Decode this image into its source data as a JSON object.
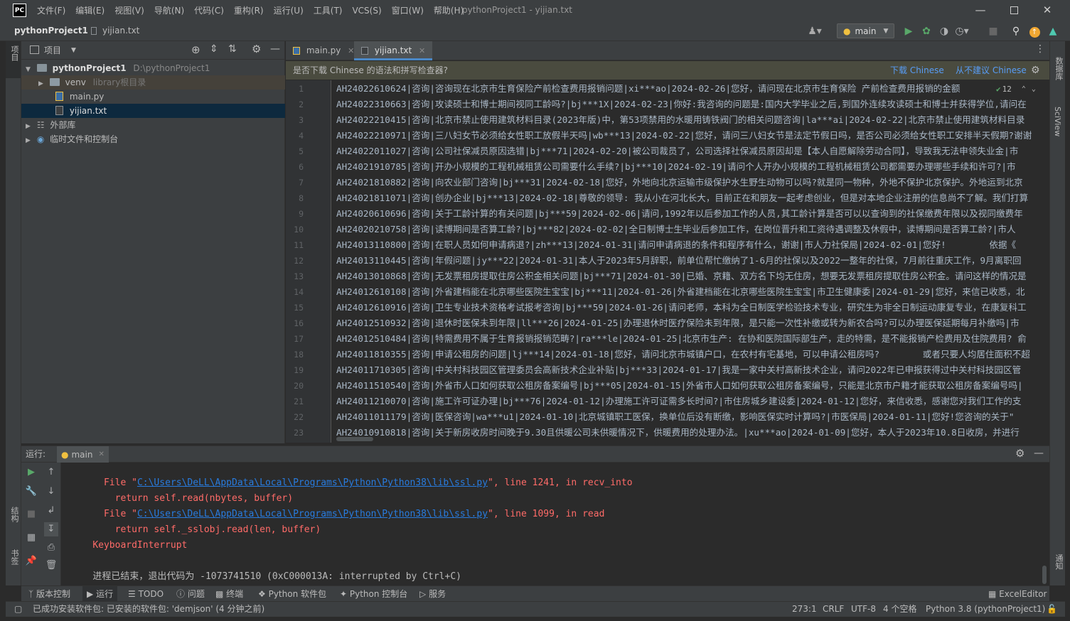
{
  "app_logo": "PC",
  "menu": [
    "文件(F)",
    "编辑(E)",
    "视图(V)",
    "导航(N)",
    "代码(C)",
    "重构(R)",
    "运行(U)",
    "工具(T)",
    "VCS(S)",
    "窗口(W)",
    "帮助(H)"
  ],
  "window_title": "pythonProject1 - yijian.txt",
  "breadcrumb": {
    "project": "pythonProject1",
    "file": "yijian.txt"
  },
  "run_config": "main",
  "project_panel": {
    "title": "项目",
    "tree": [
      {
        "label": "pythonProject1",
        "hint": "D:\\pythonProject1"
      },
      {
        "label": "venv",
        "hint": "library根目录"
      },
      {
        "label": "main.py",
        "hint": ""
      },
      {
        "label": "yijian.txt",
        "hint": ""
      },
      {
        "label": "外部库",
        "hint": ""
      },
      {
        "label": "临时文件和控制台",
        "hint": ""
      }
    ]
  },
  "editor": {
    "tabs": [
      {
        "label": "main.py"
      },
      {
        "label": "yijian.txt"
      }
    ],
    "notice": {
      "text": "是否下载 Chinese 的语法和拼写检查器?",
      "download": "下载 Chinese",
      "never": "从不建议 Chinese"
    },
    "inspection_count": "12",
    "lines": [
      "AH24022610624|咨询|咨询现在北京市生育保险产前检查费用报销问题|xi***ao|2024-02-26|您好，请问现在北京市生育保险 产前检查费用报销的金额",
      "AH24022310663|咨询|攻读硕士和博士期间视同工龄吗?|bj***1X|2024-02-23|你好:我咨询的问题是:国内大学毕业之后,到国外连续攻读硕士和博士并获得学位,请问在",
      "AH24022210415|咨询|北京市禁止使用建筑材料目录(2023年版)中，第53项禁用的水暖用铸铁阀门的相关问题咨询|la***ai|2024-02-22|北京市禁止使用建筑材料目录",
      "AH24022210971|咨询|三八妇女节必须给女性职工放假半天吗|wb***13|2024-02-22|您好，请问三八妇女节是法定节假日吗，是否公司必须给女性职工安排半天假期?谢谢",
      "AH24022011027|咨询|公司社保减员原因选错|bj***71|2024-02-20|被公司裁员了，公司选择社保减员原因却是【本人自愿解除劳动合同】，导致我无法申领失业金|市",
      "AH24021910785|咨询|开办小规模的工程机械租赁公司需要什么手续?|bj***10|2024-02-19|请问个人开办小规模的工程机械租赁公司都需要办理哪些手续和许可?|市",
      "AH24021810882|咨询|向农业部门咨询|bj***31|2024-02-18|您好，外地向北京运输市级保护水生野生动物可以吗?就是同一物种，外地不保护北京保护。外地运到北京",
      "AH24021811071|咨询|创办企业|bj***13|2024-02-18|尊敬的领导: 我从小在河北长大，目前正在和朋友一起考虑创业，但是对本地企业注册的信息尚不了解。我们打算",
      "AH24020610696|咨询|关于工龄计算的有关问题|bj***59|2024-02-06|请问,1992年以后参加工作的人员,其工龄计算是否可以以查询到的社保缴费年限以及视同缴费年",
      "AH24020210758|咨询|读博期间是否算工龄?|bj***82|2024-02-02|全日制博士生毕业后参加工作，在岗位晋升和工资待遇调整及休假中，读博期间是否算工龄?|市人",
      "AH24013110800|咨询|在职人员如何申请病退?|zh***13|2024-01-31|请问申请病退的条件和程序有什么，谢谢|市人力社保局|2024-02-01|您好!        依据《",
      "AH24013110445|咨询|年假问题|jy***22|2024-01-31|本人于2023年5月辞职，前单位帮忙缴纳了1-6月的社保以及2022一整年的社保，7月前往重庆工作，9月离职回",
      "AH24013010868|咨询|无发票租房提取住房公积金相关问题|bj***71|2024-01-30|已婚、京籍、双方名下均无住房，想要无发票租房提取住房公积金。请问这样的情况是",
      "AH24012610108|咨询|外省建档能在北京哪些医院生宝宝|bj***11|2024-01-26|外省建档能在北京哪些医院生宝宝|市卫生健康委|2024-01-29|您好，来信已收悉，北",
      "AH24012610916|咨询|卫生专业技术资格考试报考咨询|bj***59|2024-01-26|请问老师，本科为全日制医学检验技术专业，研究生为非全日制运动康复专业，在康复科工",
      "AH24012510932|咨询|退休时医保未到年限|ll***26|2024-01-25|办理退休时医疗保险未到年限，是只能一次性补缴或转为新农合吗?可以办理医保延期每月补缴吗|市",
      "AH24012510484|咨询|特需费用不属于生育报销报销范畴?|ra***le|2024-01-25|北京市生产: 在协和医院国际部生产，走的特需，是不能报销产检费用及住院费用? 俞",
      "AH24011810355|咨询|申请公租房的问题|lj***14|2024-01-18|您好，请问北京市城镇户口，在农村有宅基地，可以申请公租房吗?        或者只要人均居住面积不超",
      "AH24011710305|咨询|中关村科技园区管理委员会高新技术企业补贴|bj***33|2024-01-17|我是一家中关村高新技术企业，请问2022年已申报获得过中关村科技园区管",
      "AH24011510540|咨询|外省市人口如何获取公租房备案编号|bj***05|2024-01-15|外省市人口如何获取公租房备案编号，只能是北京市户籍才能获取公租房备案编号吗|",
      "AH24011210070|咨询|施工许可证办理|bj***76|2024-01-12|办理施工许可证需多长时间?|市住房城乡建设委|2024-01-12|您好，来信收悉，感谢您对我们工作的支",
      "AH24011011179|咨询|医保咨询|wa***u1|2024-01-10|北京城镇职工医保，换单位后没有断缴，影响医保实时计算吗?|市医保局|2024-01-11|您好!您咨询的关于\"",
      "AH24010910818|咨询|关于新房收房时间晚于9.30且供暖公司未供暖情况下，供暖费用的处理办法。|xu***ao|2024-01-09|您好，本人于2023年10.8日收房，并进行"
    ]
  },
  "run_panel": {
    "label": "运行:",
    "tab": "main",
    "console": [
      {
        "indent": "  ",
        "pre": "File \"",
        "link": "C:\\Users\\DeLL\\AppData\\Local\\Programs\\Python\\Python38\\lib\\ssl.py",
        "post": "\", line 1241, in recv_into",
        "style": "err"
      },
      {
        "indent": "    ",
        "text": "return self.read(nbytes, buffer)",
        "style": "err"
      },
      {
        "indent": "  ",
        "pre": "File \"",
        "link": "C:\\Users\\DeLL\\AppData\\Local\\Programs\\Python\\Python38\\lib\\ssl.py",
        "post": "\", line 1099, in read",
        "style": "err"
      },
      {
        "indent": "    ",
        "text": "return self._sslobj.read(len, buffer)",
        "style": "err"
      },
      {
        "indent": "",
        "text": "KeyboardInterrupt",
        "style": "err"
      },
      {
        "indent": "",
        "text": "",
        "style": "norm"
      },
      {
        "indent": "",
        "text": "进程已结束，退出代码为 -1073741510 (0xC000013A: interrupted by Ctrl+C)",
        "style": "norm"
      }
    ]
  },
  "bottom_tabs": [
    "版本控制",
    "运行",
    "TODO",
    "问题",
    "终端",
    "Python 软件包",
    "Python 控制台",
    "服务"
  ],
  "bottom_right_tab": "ExcelEditor",
  "left_stripe": {
    "project": "项目",
    "structure": "结构",
    "bookmarks": "书签"
  },
  "right_stripe": {
    "database": "数据库",
    "sciview": "SciView",
    "notifications": "通知"
  },
  "status": {
    "message": "已成功安装软件包: 已安装的软件包: 'demjson' (4 分钟之前)",
    "position": "273:1",
    "line_sep": "CRLF",
    "encoding": "UTF-8",
    "indent": "4 个空格",
    "interpreter": "Python 3.8 (pythonProject1)"
  }
}
